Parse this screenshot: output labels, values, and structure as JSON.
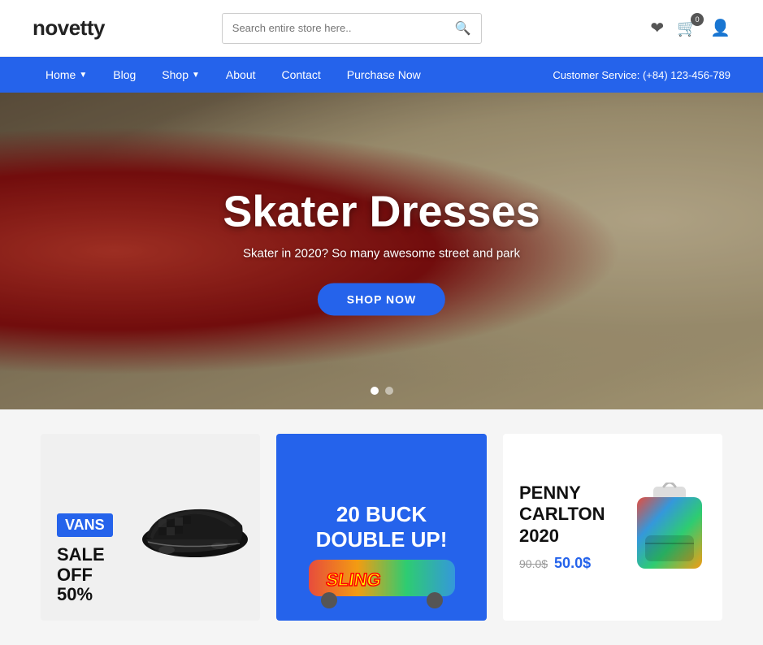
{
  "header": {
    "logo": "novetty",
    "search": {
      "placeholder": "Search entire store here..",
      "value": ""
    },
    "cart_count": "0",
    "icons": {
      "wishlist": "♡",
      "cart": "🛒",
      "account": "👤"
    }
  },
  "nav": {
    "items": [
      {
        "label": "Home",
        "has_dropdown": true
      },
      {
        "label": "Blog",
        "has_dropdown": false
      },
      {
        "label": "Shop",
        "has_dropdown": true
      },
      {
        "label": "About",
        "has_dropdown": false
      },
      {
        "label": "Contact",
        "has_dropdown": false
      },
      {
        "label": "Purchase Now",
        "has_dropdown": false
      }
    ],
    "customer_service_label": "Customer Service:",
    "customer_service_phone": "(+84) 123-456-789"
  },
  "hero": {
    "title": "Skater Dresses",
    "subtitle": "Skater in 2020? So many awesome street and park",
    "cta_label": "SHOP NOW",
    "dots": [
      {
        "active": true
      },
      {
        "active": false
      }
    ]
  },
  "cards": [
    {
      "brand": "VANS",
      "sale_line1": "SALE",
      "sale_line2": "OFF",
      "sale_line3": "50%",
      "type": "vans"
    },
    {
      "title_line1": "20 BUCK",
      "title_line2": "DOUBLE UP!",
      "type": "buck"
    },
    {
      "title_line1": "PENNY",
      "title_line2": "CARLTON",
      "title_line3": "2020",
      "old_price": "90.0$",
      "new_price": "50.0$",
      "type": "penny"
    }
  ]
}
